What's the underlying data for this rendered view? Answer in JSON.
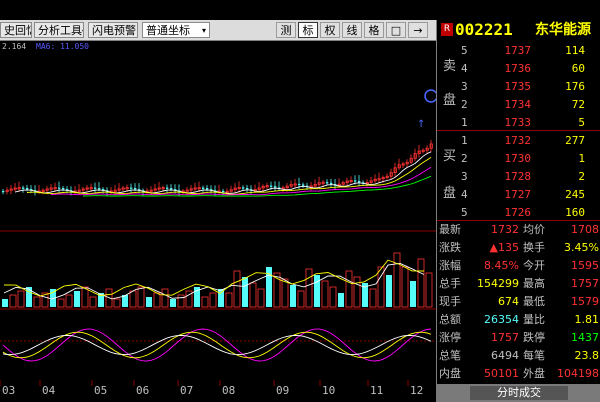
{
  "toolbar": {
    "history_label": "史回忆",
    "analysis_tools_label": "分析工具",
    "flash_alert_label": "闪电预警",
    "coord_select_value": "普通坐标",
    "right_buttons": [
      "测",
      "标",
      "权",
      "线",
      "格",
      "□",
      "→"
    ]
  },
  "chart_legend": {
    "value": "2.164",
    "ma_label": "MA6: 11.050"
  },
  "x_labels": [
    "03",
    "04",
    "05",
    "06",
    "07",
    "08",
    "09",
    "10",
    "11",
    "12"
  ],
  "stock": {
    "badge": "R",
    "code": "002221",
    "name": "东华能源"
  },
  "orderbook": {
    "sell_label": [
      "卖",
      "盘"
    ],
    "buy_label": [
      "买",
      "盘"
    ],
    "sells": [
      {
        "level": "5",
        "price": "1737",
        "volume": "114"
      },
      {
        "level": "4",
        "price": "1736",
        "volume": "60"
      },
      {
        "level": "3",
        "price": "1735",
        "volume": "176"
      },
      {
        "level": "2",
        "price": "1734",
        "volume": "72"
      },
      {
        "level": "1",
        "price": "1733",
        "volume": "5"
      }
    ],
    "buys": [
      {
        "level": "1",
        "price": "1732",
        "volume": "277"
      },
      {
        "level": "2",
        "price": "1730",
        "volume": "1"
      },
      {
        "level": "3",
        "price": "1728",
        "volume": "2"
      },
      {
        "level": "4",
        "price": "1727",
        "volume": "245"
      },
      {
        "level": "5",
        "price": "1726",
        "volume": "160"
      }
    ]
  },
  "quote": {
    "rows": [
      {
        "l1": "最新",
        "v1": "1732",
        "l2": "均价",
        "v2": "1708"
      },
      {
        "l1": "涨跌",
        "v1": "▲135",
        "l2": "换手",
        "v2": "3.45%"
      },
      {
        "l1": "涨幅",
        "v1": "8.45%",
        "l2": "今开",
        "v2": "1595"
      },
      {
        "l1": "总手",
        "v1": "154299",
        "l2": "最高",
        "v2": "1757"
      },
      {
        "l1": "现手",
        "v1": "674",
        "l2": "最低",
        "v2": "1579"
      },
      {
        "l1": "总额",
        "v1": "26354",
        "l2": "量比",
        "v2": "1.81"
      },
      {
        "l1": "涨停",
        "v1": "1757",
        "l2": "跌停",
        "v2": "1437"
      },
      {
        "l1": "总笔",
        "v1": "6494",
        "l2": "每笔",
        "v2": "23.8"
      },
      {
        "l1": "内盘",
        "v1": "50101",
        "l2": "外盘",
        "v2": "104198"
      }
    ]
  },
  "statusbar": {
    "tab_label": "分时成交"
  },
  "colors": {
    "up": "#ff3232",
    "down": "#54fcfc",
    "ma1": "#ffffff",
    "ma2": "#ffff00",
    "ma3": "#ff00ff",
    "ma4": "#00ff00",
    "code": "#ffff00",
    "name": "#ffff00"
  }
}
